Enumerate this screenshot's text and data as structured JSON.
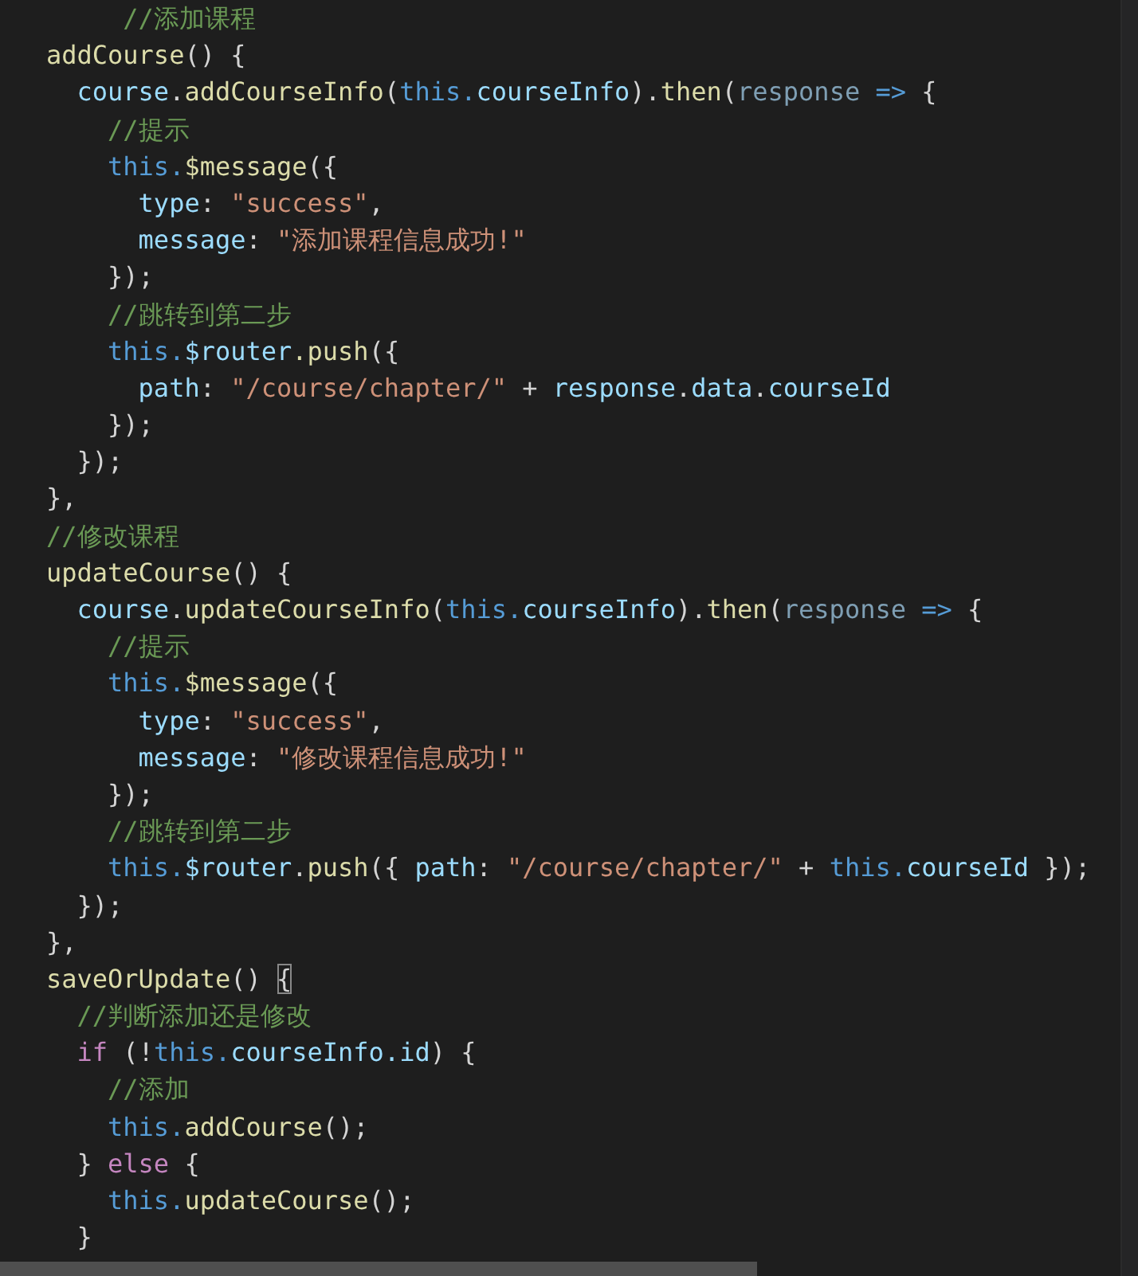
{
  "editor": {
    "lines": [
      [
        {
          "text": "     //添加课程",
          "kind": "comment"
        }
      ],
      [
        {
          "text": "addCourse",
          "kind": "func"
        },
        {
          "text": "() {",
          "kind": "punct"
        }
      ],
      [
        {
          "text": "  course",
          "kind": "var"
        },
        {
          "text": ".",
          "kind": "punct"
        },
        {
          "text": "addCourseInfo",
          "kind": "func"
        },
        {
          "text": "(",
          "kind": "punct"
        },
        {
          "text": "this.",
          "kind": "keyword"
        },
        {
          "text": "courseInfo",
          "kind": "var"
        },
        {
          "text": ").",
          "kind": "punct"
        },
        {
          "text": "then",
          "kind": "func"
        },
        {
          "text": "(",
          "kind": "punct"
        },
        {
          "text": "response ",
          "kind": "unused"
        },
        {
          "text": "=>",
          "kind": "operator"
        },
        {
          "text": " {",
          "kind": "punct"
        }
      ],
      [
        {
          "text": "    //提示",
          "kind": "comment"
        }
      ],
      [
        {
          "text": "    this.",
          "kind": "keyword"
        },
        {
          "text": "$message",
          "kind": "func"
        },
        {
          "text": "({",
          "kind": "punct"
        }
      ],
      [
        {
          "text": "      type",
          "kind": "var"
        },
        {
          "text": ": ",
          "kind": "punct"
        },
        {
          "text": "\"success\"",
          "kind": "string"
        },
        {
          "text": ",",
          "kind": "punct"
        }
      ],
      [
        {
          "text": "      message",
          "kind": "var"
        },
        {
          "text": ": ",
          "kind": "punct"
        },
        {
          "text": "\"添加课程信息成功!\"",
          "kind": "string"
        }
      ],
      [
        {
          "text": "    });",
          "kind": "punct"
        }
      ],
      [
        {
          "text": "    //跳转到第二步",
          "kind": "comment"
        }
      ],
      [
        {
          "text": "    this.",
          "kind": "keyword"
        },
        {
          "text": "$router",
          "kind": "var"
        },
        {
          "text": ".push",
          "kind": "func"
        },
        {
          "text": "({",
          "kind": "punct"
        }
      ],
      [
        {
          "text": "      path",
          "kind": "var"
        },
        {
          "text": ": ",
          "kind": "punct"
        },
        {
          "text": "\"/course/chapter/\"",
          "kind": "string"
        },
        {
          "text": " + ",
          "kind": "punct"
        },
        {
          "text": "response",
          "kind": "var"
        },
        {
          "text": ".",
          "kind": "punct"
        },
        {
          "text": "data",
          "kind": "var"
        },
        {
          "text": ".",
          "kind": "punct"
        },
        {
          "text": "courseId",
          "kind": "var"
        }
      ],
      [
        {
          "text": "    });",
          "kind": "punct"
        }
      ],
      [
        {
          "text": "  });",
          "kind": "punct"
        }
      ],
      [
        {
          "text": "},",
          "kind": "punct"
        }
      ],
      [
        {
          "text": "//修改课程",
          "kind": "comment"
        }
      ],
      [
        {
          "text": "updateCourse",
          "kind": "func"
        },
        {
          "text": "() {",
          "kind": "punct"
        }
      ],
      [
        {
          "text": "  course",
          "kind": "var"
        },
        {
          "text": ".",
          "kind": "punct"
        },
        {
          "text": "updateCourseInfo",
          "kind": "func"
        },
        {
          "text": "(",
          "kind": "punct"
        },
        {
          "text": "this.",
          "kind": "keyword"
        },
        {
          "text": "courseInfo",
          "kind": "var"
        },
        {
          "text": ").",
          "kind": "punct"
        },
        {
          "text": "then",
          "kind": "func"
        },
        {
          "text": "(",
          "kind": "punct"
        },
        {
          "text": "response ",
          "kind": "unused"
        },
        {
          "text": "=>",
          "kind": "operator"
        },
        {
          "text": " {",
          "kind": "punct"
        }
      ],
      [
        {
          "text": "    //提示",
          "kind": "comment"
        }
      ],
      [
        {
          "text": "    this.",
          "kind": "keyword"
        },
        {
          "text": "$message",
          "kind": "func"
        },
        {
          "text": "({",
          "kind": "punct"
        }
      ],
      [
        {
          "text": "      type",
          "kind": "var"
        },
        {
          "text": ": ",
          "kind": "punct"
        },
        {
          "text": "\"success\"",
          "kind": "string"
        },
        {
          "text": ",",
          "kind": "punct"
        }
      ],
      [
        {
          "text": "      message",
          "kind": "var"
        },
        {
          "text": ": ",
          "kind": "punct"
        },
        {
          "text": "\"修改课程信息成功!\"",
          "kind": "string"
        }
      ],
      [
        {
          "text": "    });",
          "kind": "punct"
        }
      ],
      [
        {
          "text": "    //跳转到第二步",
          "kind": "comment"
        }
      ],
      [
        {
          "text": "    this.",
          "kind": "keyword"
        },
        {
          "text": "$router",
          "kind": "var"
        },
        {
          "text": ".",
          "kind": "punct"
        },
        {
          "text": "push",
          "kind": "func"
        },
        {
          "text": "({ ",
          "kind": "punct"
        },
        {
          "text": "path",
          "kind": "var"
        },
        {
          "text": ": ",
          "kind": "punct"
        },
        {
          "text": "\"/course/chapter/\"",
          "kind": "string"
        },
        {
          "text": " + ",
          "kind": "punct"
        },
        {
          "text": "this.",
          "kind": "keyword"
        },
        {
          "text": "courseId",
          "kind": "var"
        },
        {
          "text": " });",
          "kind": "punct"
        }
      ],
      [
        {
          "text": "  });",
          "kind": "punct"
        }
      ],
      [
        {
          "text": "},",
          "kind": "punct"
        }
      ],
      [
        {
          "text": "saveOrUpdate",
          "kind": "func"
        },
        {
          "text": "() ",
          "kind": "punct"
        },
        {
          "text": "{",
          "kind": "bracket-match"
        }
      ],
      [
        {
          "text": "  //判断添加还是修改",
          "kind": "comment"
        }
      ],
      [
        {
          "text": "  if",
          "kind": "control"
        },
        {
          "text": " (!",
          "kind": "punct"
        },
        {
          "text": "this.",
          "kind": "keyword"
        },
        {
          "text": "courseInfo",
          "kind": "var"
        },
        {
          "text": ".id",
          "kind": "var"
        },
        {
          "text": ") {",
          "kind": "punct"
        }
      ],
      [
        {
          "text": "    //添加",
          "kind": "comment"
        }
      ],
      [
        {
          "text": "    this.",
          "kind": "keyword"
        },
        {
          "text": "addCourse",
          "kind": "func"
        },
        {
          "text": "();",
          "kind": "punct"
        }
      ],
      [
        {
          "text": "  } ",
          "kind": "punct"
        },
        {
          "text": "else",
          "kind": "control"
        },
        {
          "text": " {",
          "kind": "punct"
        }
      ],
      [
        {
          "text": "    this.",
          "kind": "keyword"
        },
        {
          "text": "updateCourse",
          "kind": "func"
        },
        {
          "text": "();",
          "kind": "punct"
        }
      ],
      [
        {
          "text": "  }",
          "kind": "punct"
        }
      ]
    ]
  }
}
